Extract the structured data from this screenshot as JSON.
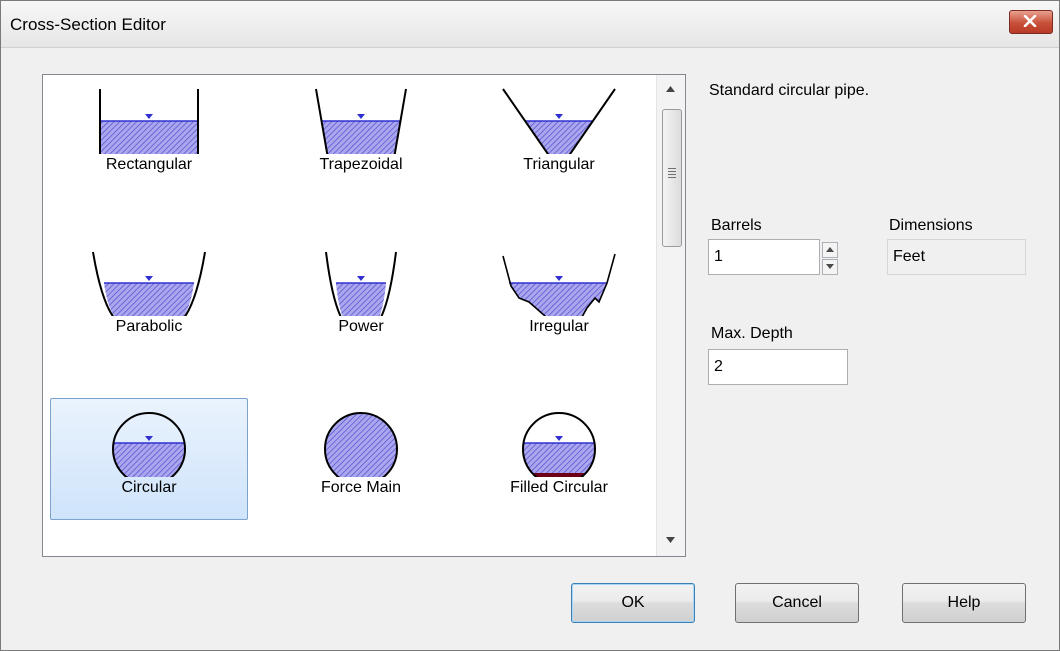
{
  "window": {
    "title": "Cross-Section Editor"
  },
  "shapes": [
    {
      "label": "Rectangular",
      "icon": "rectangular-channel-icon"
    },
    {
      "label": "Trapezoidal",
      "icon": "trapezoidal-channel-icon"
    },
    {
      "label": "Triangular",
      "icon": "triangular-channel-icon"
    },
    {
      "label": "Parabolic",
      "icon": "parabolic-channel-icon"
    },
    {
      "label": "Power",
      "icon": "power-channel-icon"
    },
    {
      "label": "Irregular",
      "icon": "irregular-channel-icon"
    },
    {
      "label": "Circular",
      "icon": "circular-pipe-icon",
      "selected": true
    },
    {
      "label": "Force Main",
      "icon": "force-main-pipe-icon"
    },
    {
      "label": "Filled Circular",
      "icon": "filled-circular-pipe-icon"
    }
  ],
  "description": "Standard circular pipe.",
  "barrels": {
    "label": "Barrels",
    "value": "1"
  },
  "dimensions": {
    "label": "Dimensions",
    "value": "Feet"
  },
  "max_depth": {
    "label": "Max. Depth",
    "value": "2"
  },
  "buttons": {
    "ok": "OK",
    "cancel": "Cancel",
    "help": "Help"
  },
  "colors": {
    "water_fill": "#a9a6ee",
    "water_line": "#3030d0",
    "sediment": "#700018",
    "selection": "#cfe4fb"
  }
}
